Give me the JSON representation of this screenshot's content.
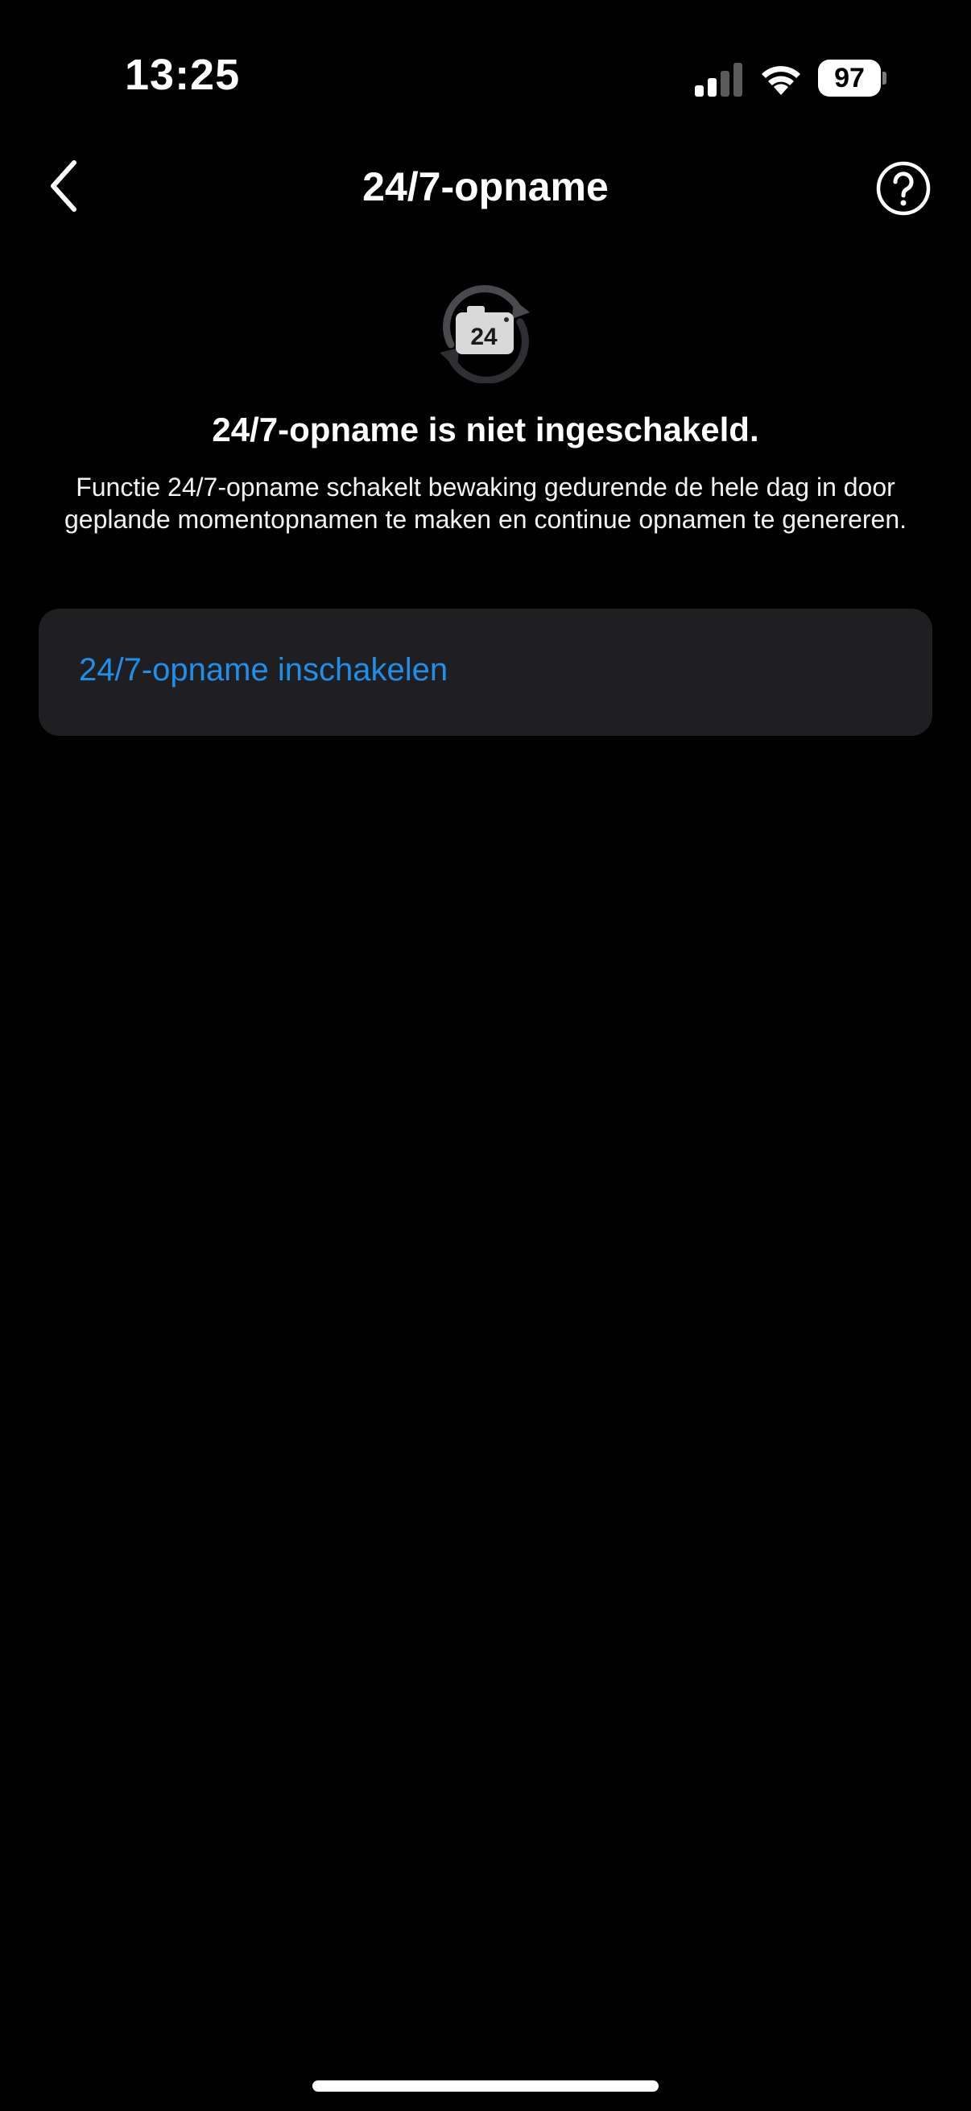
{
  "status_bar": {
    "time": "13:25",
    "battery_level": "97",
    "signal_icon": "cellular-signal-icon",
    "wifi_icon": "wifi-icon"
  },
  "nav": {
    "title": "24/7-opname",
    "back_icon": "chevron-left-icon",
    "help_icon": "help-circle-icon"
  },
  "hero": {
    "icon": "continuous-recording-camera-icon",
    "icon_label": "24",
    "title": "24/7-opname is niet ingeschakeld.",
    "description": "Functie 24/7-opname schakelt bewaking gedurende de hele dag in door geplande momentopnamen te maken en continue opnamen te genereren."
  },
  "action": {
    "label": "24/7-opname inschakelen"
  },
  "colors": {
    "background": "#000000",
    "card": "#1f1f22",
    "accent": "#1f8fea",
    "text": "#ffffff"
  }
}
